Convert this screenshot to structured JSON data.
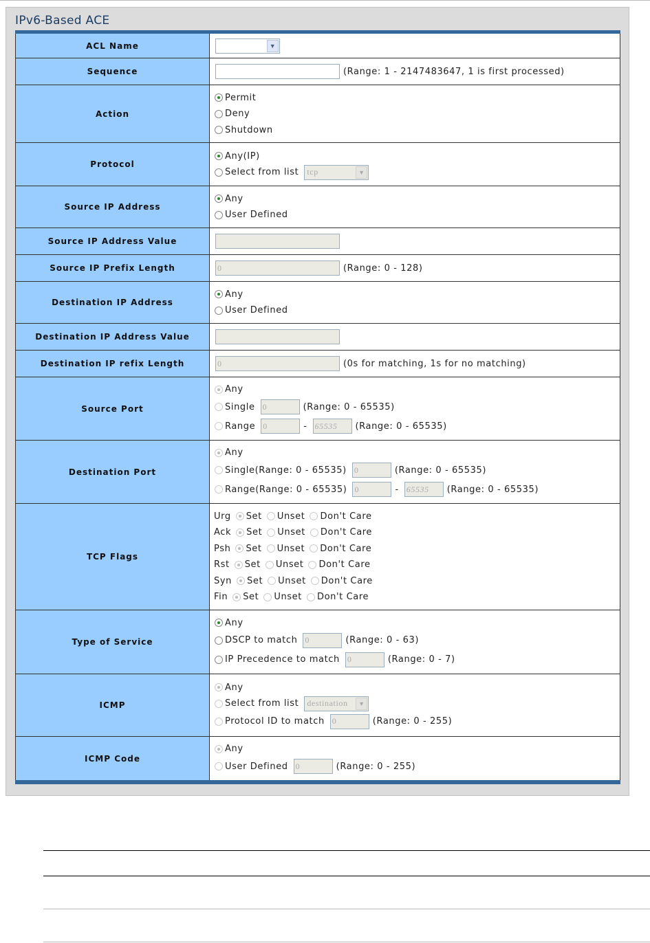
{
  "title": "IPv6-Based ACE",
  "colors": {
    "label_bg": "#99ccff",
    "accent": "#336699",
    "title": "#1b3d63"
  },
  "rows": [
    {
      "label": "ACL Name",
      "h": 35,
      "lines": [
        [
          {
            "t": "select",
            "v": "",
            "w": 94
          }
        ]
      ]
    },
    {
      "label": "Sequence",
      "h": 38,
      "lines": [
        [
          {
            "t": "input",
            "v": "",
            "w": 181
          },
          {
            "t": "text",
            "v": "(Range: 1 - 2147483647, 1 is first processed)"
          }
        ]
      ]
    },
    {
      "label": "Action",
      "h": 83,
      "lines": [
        [
          {
            "t": "radio",
            "on": true
          },
          {
            "t": "text",
            "v": "Permit"
          }
        ],
        [
          {
            "t": "radio"
          },
          {
            "t": "text",
            "v": "Deny"
          }
        ],
        [
          {
            "t": "radio"
          },
          {
            "t": "text",
            "v": "Shutdown"
          }
        ]
      ]
    },
    {
      "label": "Protocol",
      "h": 62,
      "lines": [
        [
          {
            "t": "radio",
            "on": true
          },
          {
            "t": "text",
            "v": "Any(IP)"
          }
        ],
        [
          {
            "t": "radio"
          },
          {
            "t": "text",
            "v": "Select from list"
          },
          {
            "t": "select",
            "v": "tcp",
            "w": 94,
            "dis": true
          }
        ]
      ]
    },
    {
      "label": "Source IP Address",
      "h": 60,
      "lines": [
        [
          {
            "t": "radio",
            "on": true
          },
          {
            "t": "text",
            "v": "Any"
          }
        ],
        [
          {
            "t": "radio"
          },
          {
            "t": "text",
            "v": "User Defined"
          }
        ]
      ]
    },
    {
      "label": "Source IP Address Value",
      "h": 38,
      "lines": [
        [
          {
            "t": "input",
            "v": "",
            "w": 181,
            "dis": true
          }
        ]
      ]
    },
    {
      "label": "Source IP Prefix Length",
      "h": 38,
      "lines": [
        [
          {
            "t": "input",
            "v": "0",
            "w": 181,
            "dis": true
          },
          {
            "t": "text",
            "v": "(Range: 0 - 128)"
          }
        ]
      ]
    },
    {
      "label": "Destination IP Address",
      "h": 60,
      "lines": [
        [
          {
            "t": "radio",
            "on": true
          },
          {
            "t": "text",
            "v": "Any"
          }
        ],
        [
          {
            "t": "radio"
          },
          {
            "t": "text",
            "v": "User Defined"
          }
        ]
      ]
    },
    {
      "label": "Destination IP Address Value",
      "h": 38,
      "lines": [
        [
          {
            "t": "input",
            "v": "",
            "w": 181,
            "dis": true
          }
        ]
      ]
    },
    {
      "label": "Destination IP refix Length",
      "h": 38,
      "lines": [
        [
          {
            "t": "input",
            "v": "0",
            "w": 181,
            "dis": true
          },
          {
            "t": "text",
            "v": "(0s for matching, 1s for no matching)"
          }
        ]
      ]
    },
    {
      "label": "Source Port",
      "h": 91,
      "lines": [
        [
          {
            "t": "radio",
            "on": true,
            "dis": true
          },
          {
            "t": "text",
            "v": "Any"
          }
        ],
        [
          {
            "t": "radio",
            "dis": true
          },
          {
            "t": "text",
            "v": "Single"
          },
          {
            "t": "input",
            "v": "0",
            "w": 57,
            "dis": true
          },
          {
            "t": "text",
            "v": "(Range: 0 - 65535)"
          }
        ],
        [
          {
            "t": "radio",
            "dis": true
          },
          {
            "t": "text",
            "v": "Range"
          },
          {
            "t": "input",
            "v": "0",
            "w": 57,
            "dis": true
          },
          {
            "t": "text",
            "v": "-"
          },
          {
            "t": "input",
            "v": "65535",
            "w": 57,
            "dis": true,
            "it": true
          },
          {
            "t": "text",
            "v": "(Range: 0 - 65535)"
          }
        ]
      ]
    },
    {
      "label": "Destination Port",
      "h": 91,
      "lines": [
        [
          {
            "t": "radio",
            "on": true,
            "dis": true
          },
          {
            "t": "text",
            "v": "Any"
          }
        ],
        [
          {
            "t": "radio",
            "dis": true
          },
          {
            "t": "text",
            "v": "Single(Range: 0 - 65535)"
          },
          {
            "t": "input",
            "v": "0",
            "w": 57,
            "dis": true
          },
          {
            "t": "text",
            "v": "(Range: 0 - 65535)"
          }
        ],
        [
          {
            "t": "radio",
            "dis": true
          },
          {
            "t": "text",
            "v": "Range(Range: 0 - 65535)"
          },
          {
            "t": "input",
            "v": "0",
            "w": 57,
            "dis": true
          },
          {
            "t": "text",
            "v": "-"
          },
          {
            "t": "input",
            "v": "65535",
            "w": 57,
            "dis": true,
            "it": true
          },
          {
            "t": "text",
            "v": "(Range: 0 - 65535)"
          }
        ]
      ]
    },
    {
      "label": "TCP Flags",
      "h": 154,
      "lines": [
        [
          {
            "t": "text",
            "v": "Urg"
          },
          {
            "t": "radio",
            "on": true,
            "dis": true
          },
          {
            "t": "text",
            "v": "Set"
          },
          {
            "t": "radio",
            "dis": true
          },
          {
            "t": "text",
            "v": "Unset"
          },
          {
            "t": "radio",
            "dis": true
          },
          {
            "t": "text",
            "v": "Don't Care"
          }
        ],
        [
          {
            "t": "text",
            "v": "Ack"
          },
          {
            "t": "radio",
            "on": true,
            "dis": true
          },
          {
            "t": "text",
            "v": "Set"
          },
          {
            "t": "radio",
            "dis": true
          },
          {
            "t": "text",
            "v": "Unset"
          },
          {
            "t": "radio",
            "dis": true
          },
          {
            "t": "text",
            "v": "Don't Care"
          }
        ],
        [
          {
            "t": "text",
            "v": "Psh"
          },
          {
            "t": "radio",
            "on": true,
            "dis": true
          },
          {
            "t": "text",
            "v": "Set"
          },
          {
            "t": "radio",
            "dis": true
          },
          {
            "t": "text",
            "v": "Unset"
          },
          {
            "t": "radio",
            "dis": true
          },
          {
            "t": "text",
            "v": "Don't Care"
          }
        ],
        [
          {
            "t": "text",
            "v": "Rst"
          },
          {
            "t": "radio",
            "on": true,
            "dis": true
          },
          {
            "t": "text",
            "v": "Set"
          },
          {
            "t": "radio",
            "dis": true
          },
          {
            "t": "text",
            "v": "Unset"
          },
          {
            "t": "radio",
            "dis": true
          },
          {
            "t": "text",
            "v": "Don't Care"
          }
        ],
        [
          {
            "t": "text",
            "v": "Syn"
          },
          {
            "t": "radio",
            "on": true,
            "dis": true
          },
          {
            "t": "text",
            "v": "Set"
          },
          {
            "t": "radio",
            "dis": true
          },
          {
            "t": "text",
            "v": "Unset"
          },
          {
            "t": "radio",
            "dis": true
          },
          {
            "t": "text",
            "v": "Don't Care"
          }
        ],
        [
          {
            "t": "text",
            "v": "Fin"
          },
          {
            "t": "radio",
            "on": true,
            "dis": true
          },
          {
            "t": "text",
            "v": "Set"
          },
          {
            "t": "radio",
            "dis": true
          },
          {
            "t": "text",
            "v": "Unset"
          },
          {
            "t": "radio",
            "dis": true
          },
          {
            "t": "text",
            "v": "Don't Care"
          }
        ]
      ]
    },
    {
      "label": "Type of Service",
      "h": 92,
      "lines": [
        [
          {
            "t": "radio",
            "on": true
          },
          {
            "t": "text",
            "v": "Any"
          }
        ],
        [
          {
            "t": "radio"
          },
          {
            "t": "text",
            "v": "DSCP to match"
          },
          {
            "t": "input",
            "v": "0",
            "w": 57,
            "dis": true
          },
          {
            "t": "text",
            "v": "(Range: 0 - 63)"
          }
        ],
        [
          {
            "t": "radio"
          },
          {
            "t": "text",
            "v": "IP Precedence to match"
          },
          {
            "t": "input",
            "v": "0",
            "w": 57,
            "dis": true
          },
          {
            "t": "text",
            "v": "(Range: 0 - 7)"
          }
        ]
      ]
    },
    {
      "label": "ICMP",
      "h": 90,
      "lines": [
        [
          {
            "t": "radio",
            "on": true,
            "dis": true
          },
          {
            "t": "text",
            "v": "Any"
          }
        ],
        [
          {
            "t": "radio",
            "dis": true
          },
          {
            "t": "text",
            "v": "Select from list"
          },
          {
            "t": "select",
            "v": "destination",
            "w": 94,
            "dis": true
          }
        ],
        [
          {
            "t": "radio",
            "dis": true
          },
          {
            "t": "text",
            "v": "Protocol ID to match"
          },
          {
            "t": "input",
            "v": "0",
            "w": 57,
            "dis": true
          },
          {
            "t": "text",
            "v": "(Range: 0 - 255)"
          }
        ]
      ]
    },
    {
      "label": "ICMP Code",
      "h": 63,
      "lines": [
        [
          {
            "t": "radio",
            "on": true,
            "dis": true
          },
          {
            "t": "text",
            "v": "Any"
          }
        ],
        [
          {
            "t": "radio",
            "dis": true
          },
          {
            "t": "text",
            "v": "User Defined"
          },
          {
            "t": "input",
            "v": "0",
            "w": 57,
            "dis": true
          },
          {
            "t": "text",
            "v": "(Range: 0 - 255)"
          }
        ]
      ]
    }
  ]
}
